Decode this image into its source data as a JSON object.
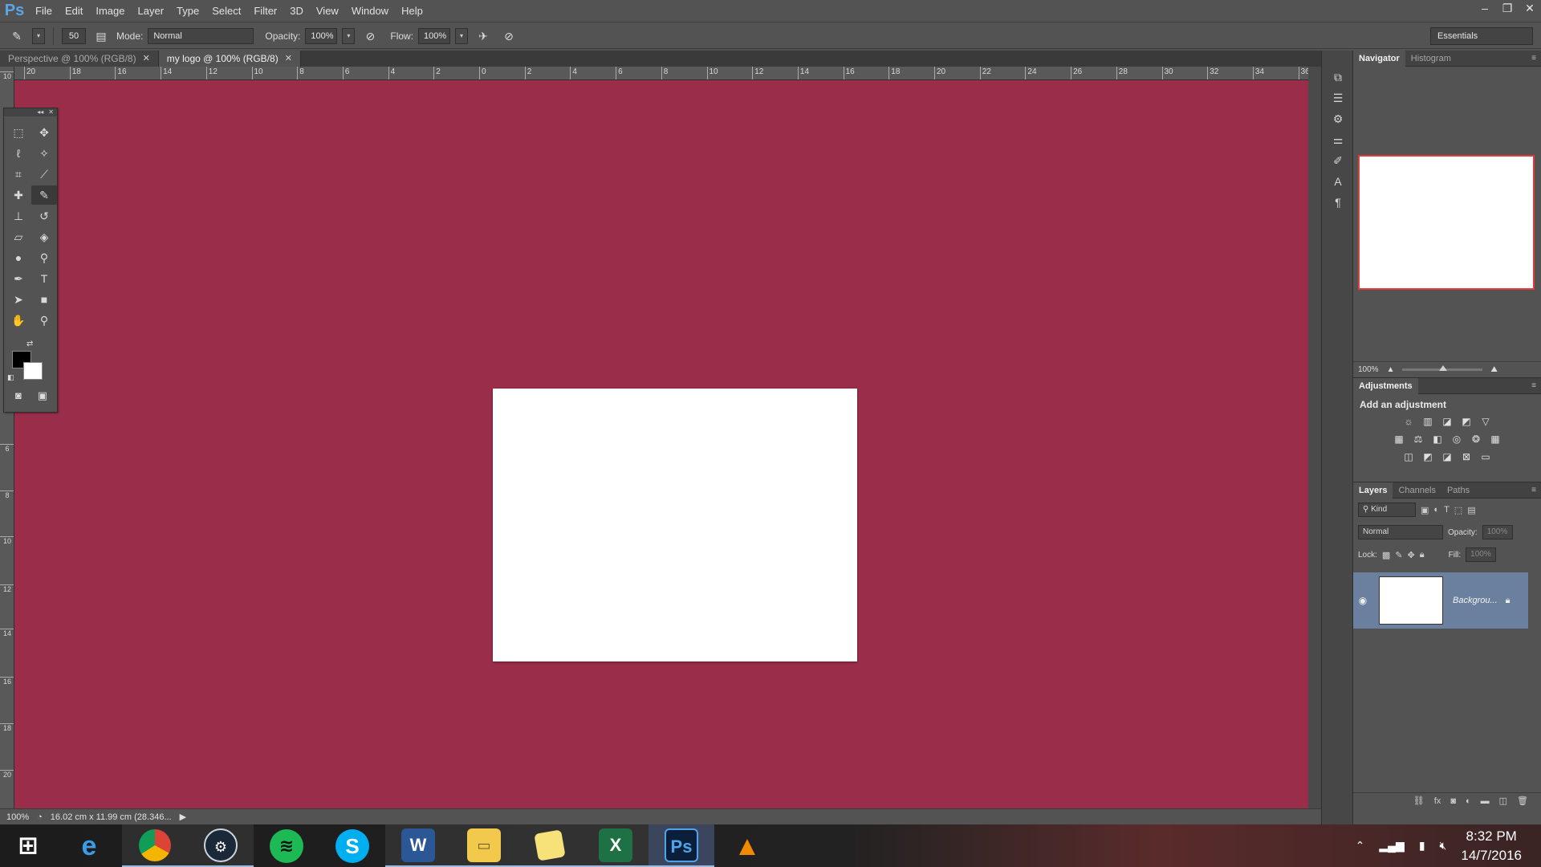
{
  "app": {
    "logo": "Ps",
    "menus": [
      "File",
      "Edit",
      "Image",
      "Layer",
      "Type",
      "Select",
      "Filter",
      "3D",
      "View",
      "Window",
      "Help"
    ]
  },
  "window_controls": [
    "–",
    "❐",
    "✕"
  ],
  "options": {
    "brush_size": "50",
    "mode_label": "Mode:",
    "mode_value": "Normal",
    "opacity_label": "Opacity:",
    "opacity_value": "100%",
    "flow_label": "Flow:",
    "flow_value": "100%",
    "workspace": "Essentials"
  },
  "doc_tabs": [
    {
      "label": "Perspective @ 100% (RGB/8)",
      "active": false
    },
    {
      "label": "my logo @ 100% (RGB/8)",
      "active": true
    }
  ],
  "ruler_h": [
    "20",
    "18",
    "16",
    "14",
    "12",
    "10",
    "8",
    "6",
    "4",
    "2",
    "0",
    "2",
    "4",
    "6",
    "8",
    "10",
    "12",
    "14",
    "16",
    "18",
    "20",
    "22",
    "24",
    "26",
    "28",
    "30",
    "32",
    "34",
    "36"
  ],
  "ruler_v": [
    "10",
    "6",
    "8",
    "10",
    "12",
    "14",
    "16",
    "18",
    "20"
  ],
  "status": {
    "zoom": "100%",
    "doc_info": "16.02 cm x 11.99 cm (28.346..."
  },
  "colors": {
    "canvas_bg": "#9a2e4a",
    "foreground": "#000000",
    "background": "#ffffff",
    "nav_frame": "#e23b3b"
  },
  "panels": {
    "navigator_tabs": [
      "Navigator",
      "Histogram"
    ],
    "navigator_zoom": "100%",
    "adjustments_tab": "Adjustments",
    "adjustments_title": "Add an adjustment",
    "layers_tabs": [
      "Layers",
      "Channels",
      "Paths"
    ],
    "layers_kind": "Kind",
    "layers_blend": "Normal",
    "layers_opacity_label": "Opacity:",
    "layers_opacity_value": "100%",
    "lock_label": "Lock:",
    "fill_label": "Fill:",
    "fill_value": "100%",
    "layer_name": "Backgrou..."
  },
  "taskbar": {
    "apps": [
      "Windows Start",
      "Internet Explorer",
      "Chrome",
      "Steam",
      "Spotify",
      "Skype",
      "Word",
      "File Explorer",
      "Sticky Notes",
      "Excel",
      "Photoshop",
      "VLC"
    ],
    "time": "8:32 PM",
    "date": "14/7/2016"
  }
}
